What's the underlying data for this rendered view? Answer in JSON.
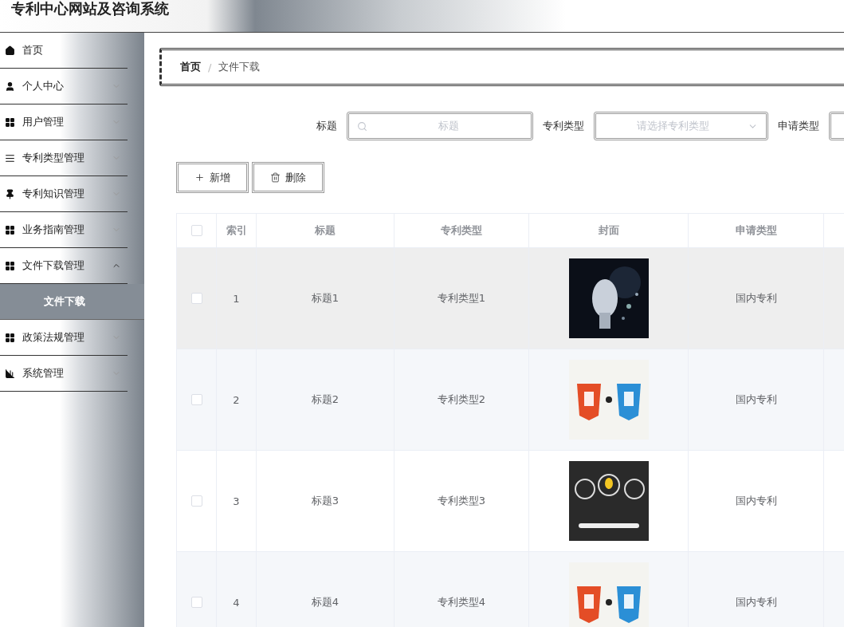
{
  "header": {
    "title": "专利中心网站及咨询系统"
  },
  "sidebar": {
    "items": [
      {
        "label": "首页"
      },
      {
        "label": "个人中心",
        "expanded": false
      },
      {
        "label": "用户管理",
        "expanded": false
      },
      {
        "label": "专利类型管理",
        "expanded": false
      },
      {
        "label": "专利知识管理",
        "expanded": false
      },
      {
        "label": "业务指南管理",
        "expanded": false
      },
      {
        "label": "文件下载管理",
        "expanded": true,
        "children": [
          {
            "label": "文件下载",
            "selected": true
          }
        ]
      },
      {
        "label": "政策法规管理",
        "expanded": false
      },
      {
        "label": "系统管理",
        "expanded": false
      }
    ]
  },
  "breadcrumb": {
    "items": [
      "首页",
      "文件下载"
    ],
    "separator": "/"
  },
  "search": {
    "fields": [
      {
        "kind": "text",
        "label": "标题",
        "placeholder": "标题"
      },
      {
        "kind": "select",
        "label": "专利类型",
        "placeholder": "请选择专利类型"
      },
      {
        "kind": "select",
        "label": "申请类型"
      }
    ]
  },
  "actions": [
    {
      "kind": "add",
      "label": "新增"
    },
    {
      "kind": "delete",
      "label": "删除"
    }
  ],
  "table": {
    "all_checked": false,
    "columns": [
      "索引",
      "标题",
      "专利类型",
      "封面",
      "申请类型"
    ],
    "rows": [
      {
        "checked": false,
        "hovered": true,
        "index": "1",
        "title": "标题1",
        "type": "专利类型1",
        "apply_type": "国内专利"
      },
      {
        "checked": false,
        "hovered": false,
        "index": "2",
        "title": "标题2",
        "type": "专利类型2",
        "apply_type": "国内专利"
      },
      {
        "checked": false,
        "hovered": false,
        "index": "3",
        "title": "标题3",
        "type": "专利类型3",
        "apply_type": "国内专利"
      },
      {
        "checked": false,
        "hovered": false,
        "index": "4",
        "title": "标题4",
        "type": "专利类型4",
        "apply_type": "国内专利"
      }
    ]
  }
}
